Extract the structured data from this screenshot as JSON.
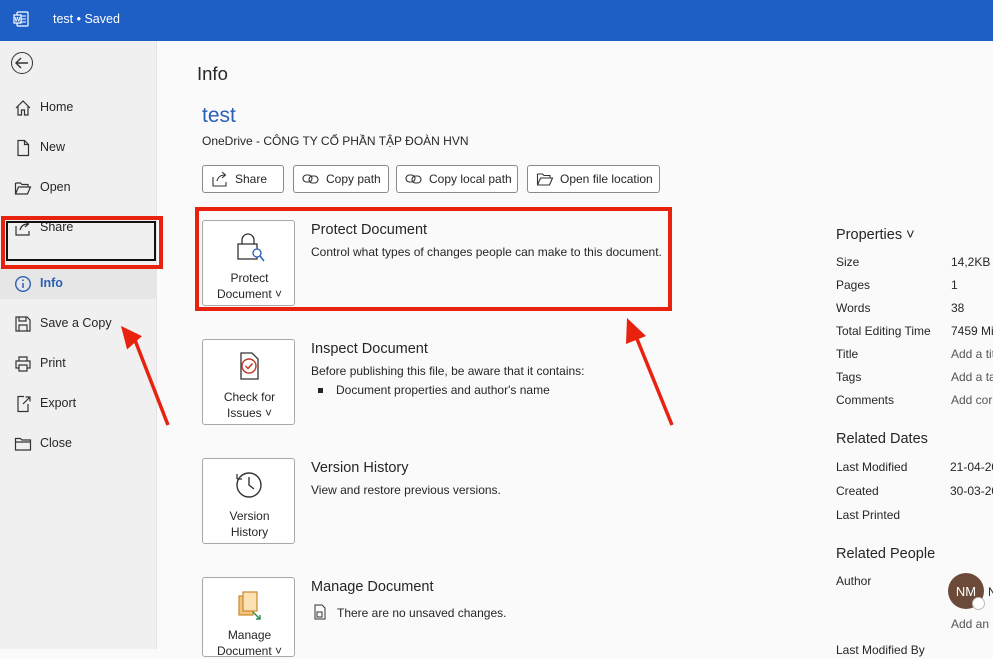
{
  "titlebar": {
    "doc_title": "test • Saved"
  },
  "sidebar": {
    "items": [
      {
        "label": "Home"
      },
      {
        "label": "New"
      },
      {
        "label": "Open"
      },
      {
        "label": "Share"
      },
      {
        "label": "Info"
      },
      {
        "label": "Save a Copy"
      },
      {
        "label": "Print"
      },
      {
        "label": "Export"
      },
      {
        "label": "Close"
      }
    ]
  },
  "main": {
    "title": "Info",
    "doc_name": "test",
    "doc_location": "OneDrive - CÔNG TY CỔ PHẦN TẬP ĐOÀN HVN",
    "buttons": {
      "share": "Share",
      "copy_path": "Copy path",
      "copy_local_path": "Copy local path",
      "open_file_location": "Open file location"
    },
    "sections": {
      "protect": {
        "button_line1": "Protect",
        "button_line2": "Document ˅",
        "title": "Protect Document",
        "desc": "Control what types of changes people can make to this document."
      },
      "inspect": {
        "button_line1": "Check for",
        "button_line2": "Issues ˅",
        "title": "Inspect Document",
        "desc": "Before publishing this file, be aware that it contains:",
        "bullet": "Document properties and author's name"
      },
      "version": {
        "button_line1": "Version",
        "button_line2": "History",
        "title": "Version History",
        "desc": "View and restore previous versions."
      },
      "manage": {
        "button_line1": "Manage",
        "button_line2": "Document ˅",
        "title": "Manage Document",
        "desc": "There are no unsaved changes."
      }
    }
  },
  "properties": {
    "heading": "Properties ˅",
    "rows": [
      {
        "key": "Size",
        "value": "14,2KB"
      },
      {
        "key": "Pages",
        "value": "1"
      },
      {
        "key": "Words",
        "value": "38"
      },
      {
        "key": "Total Editing Time",
        "value": "7459 Mi"
      },
      {
        "key": "Title",
        "value": "Add a tit"
      },
      {
        "key": "Tags",
        "value": "Add a ta"
      },
      {
        "key": "Comments",
        "value": "Add cor"
      }
    ],
    "related_dates_heading": "Related Dates",
    "dates": [
      {
        "key": "Last Modified",
        "value": "21-04-20"
      },
      {
        "key": "Created",
        "value": "30-03-20"
      },
      {
        "key": "Last Printed",
        "value": ""
      }
    ],
    "related_people_heading": "Related People",
    "author_label": "Author",
    "author_initials": "NM",
    "author_name_partial": "N",
    "add_author": "Add an",
    "last_modified_by": "Last Modified By"
  }
}
